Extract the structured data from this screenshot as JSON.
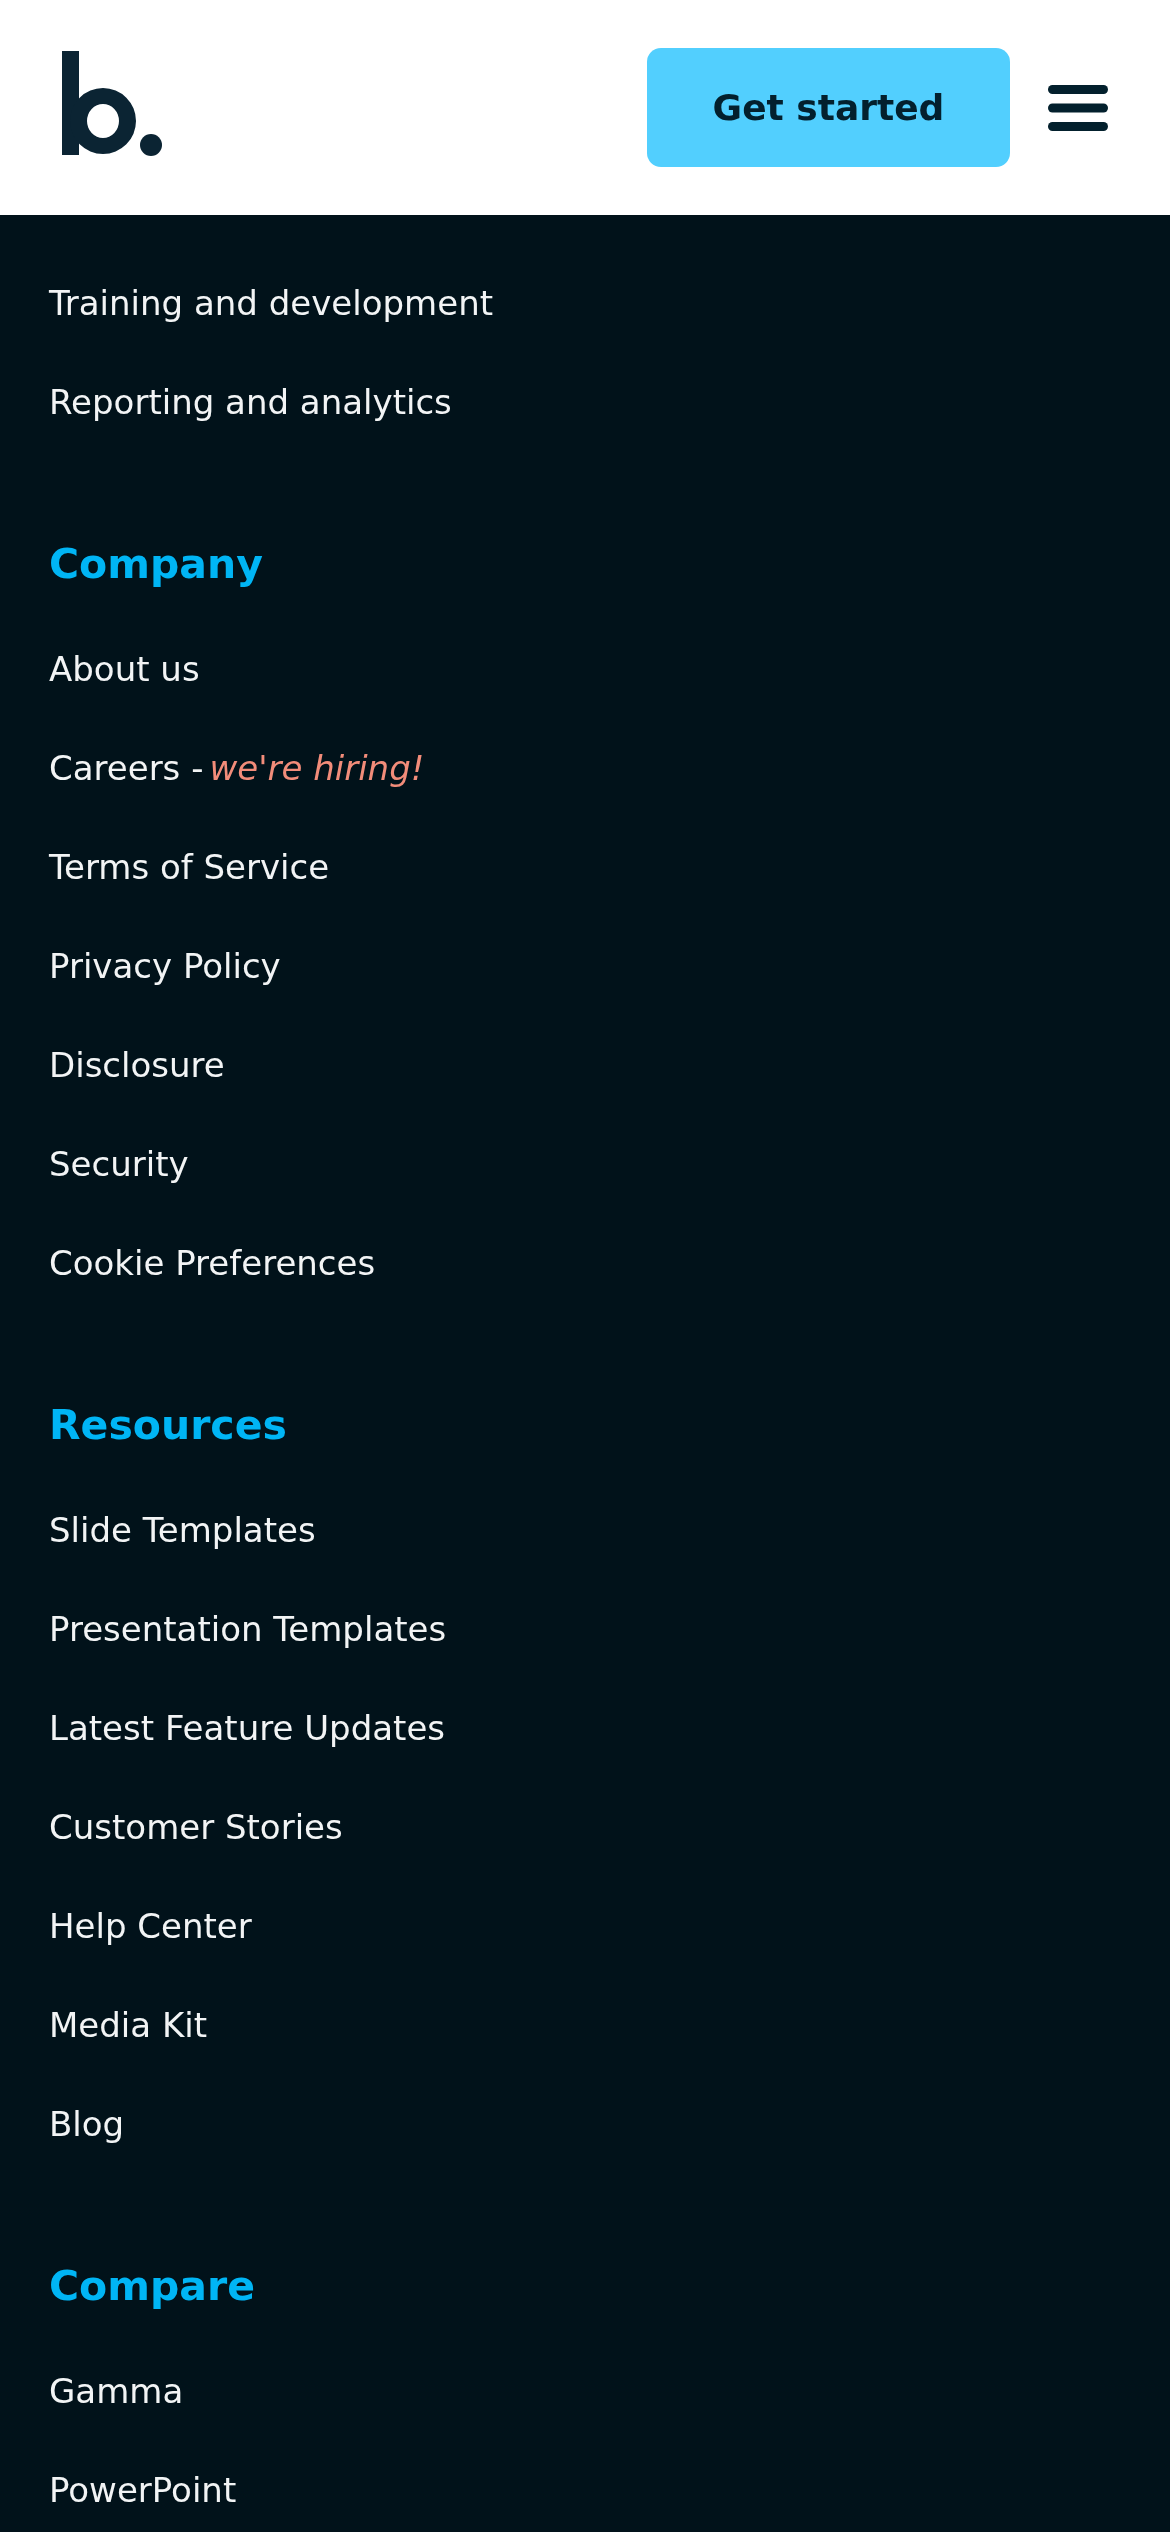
{
  "header": {
    "button": "Get started"
  },
  "sections": [
    {
      "items": [
        {
          "label": "Training and development"
        },
        {
          "label": "Reporting and analytics"
        }
      ]
    },
    {
      "title": "Company",
      "items": [
        {
          "label": "About us"
        },
        {
          "label": "Careers - ",
          "tag": "we're hiring!"
        },
        {
          "label": "Terms of Service"
        },
        {
          "label": "Privacy Policy"
        },
        {
          "label": "Disclosure"
        },
        {
          "label": "Security"
        },
        {
          "label": "Cookie Preferences"
        }
      ]
    },
    {
      "title": "Resources",
      "items": [
        {
          "label": "Slide Templates"
        },
        {
          "label": "Presentation Templates"
        },
        {
          "label": "Latest Feature Updates"
        },
        {
          "label": "Customer Stories"
        },
        {
          "label": "Help Center"
        },
        {
          "label": "Media Kit"
        },
        {
          "label": "Blog"
        }
      ]
    },
    {
      "title": "Compare",
      "items": [
        {
          "label": "Gamma"
        },
        {
          "label": "PowerPoint"
        }
      ]
    }
  ]
}
